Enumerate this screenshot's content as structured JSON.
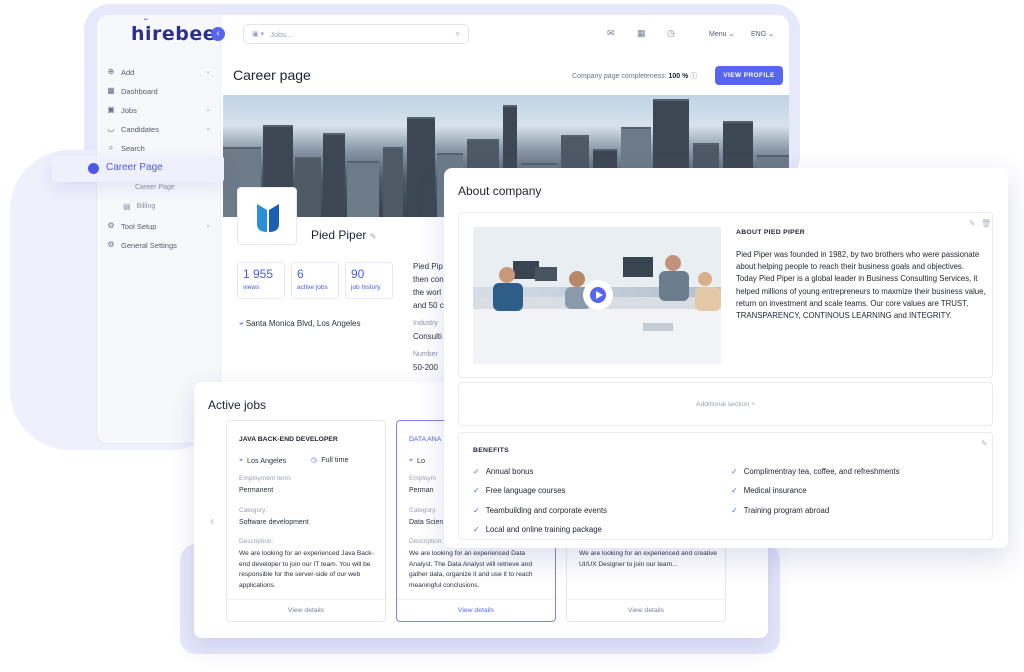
{
  "app": {
    "logo": "hirebee",
    "collapse_icon": "chevron-left-icon",
    "search_placeholder": "Jobs...",
    "menu_label": "Menu",
    "lang_label": "ENG",
    "sidebar": [
      {
        "label": "Add",
        "icon": "plus-circle-icon",
        "has_chevron": true
      },
      {
        "label": "Dashboard",
        "icon": "grid-icon",
        "has_chevron": false
      },
      {
        "label": "Jobs",
        "icon": "briefcase-icon",
        "has_chevron": true
      },
      {
        "label": "Candidates",
        "icon": "user-icon",
        "has_chevron": true
      },
      {
        "label": "Search",
        "icon": "search-icon",
        "has_chevron": false
      }
    ],
    "career_page_label": "Career Page",
    "sub_items": [
      {
        "label": "Career Page"
      },
      {
        "label": "Billing",
        "icon": "card-icon"
      }
    ],
    "sidebar_bottom": [
      {
        "label": "Tool Setup",
        "icon": "tool-icon",
        "has_chevron": true
      },
      {
        "label": "General Settings",
        "icon": "gear-icon",
        "has_chevron": false
      }
    ],
    "page_title": "Career page",
    "completeness_label": "Company page completeness:",
    "completeness_value": "100 %",
    "view_profile_label": "VIEW PROFILE"
  },
  "company": {
    "name": "Pied Piper",
    "stats": [
      {
        "value": "1 955",
        "label": "views"
      },
      {
        "value": "6",
        "label": "active jobs"
      },
      {
        "value": "90",
        "label": "job history"
      }
    ],
    "location": "Santa Monica Blvd, Los Angeles",
    "desc_fragments": [
      "Pied Pip",
      "then con",
      "the worl",
      "and 50 c"
    ],
    "industry_label": "Industry",
    "industry_value": "Consulti",
    "number_label": "Number",
    "number_value": "50-200"
  },
  "jobs": {
    "title": "Active jobs",
    "cards": [
      {
        "title": "JAVA BACK-END DEVELOPER",
        "location": "Los Angeles",
        "term_type": "Full time",
        "employment_label": "Employment term:",
        "employment_value": "Permanent",
        "category_label": "Category:",
        "category_value": "Software development",
        "description_label": "Description:",
        "description": "We are looking for an experienced Java Back-end developer to join our IT team. You will be responsible for the server-side of our web applications.",
        "footer": "View details"
      },
      {
        "title": "DATA ANA",
        "location": "Lo",
        "employment_label": "Employm",
        "employment_value": "Perman",
        "category_label": "Category:",
        "category_value": "Data Scien",
        "description_label": "Description:",
        "description": "We are looking for an experienced Data Analyst. The Data Analyst will retrieve and gather data, organize it and use it to reach meaningful conclusions.",
        "footer": "View details"
      },
      {
        "description": "We are looking for an experienced and creative UI/UX Designer to join our team...",
        "footer": "View details"
      }
    ]
  },
  "about": {
    "title": "About company",
    "heading": "ABOUT PIED PIPER",
    "text": "Pied Piper was founded in 1982, by two brothers who were passionate about helping people to reach their business goals and objectives. Today Pied Piper is a global leader in Business Consulting Services, it helped millions of young entrepreneurs to maxmize their business value, return on investment and scale teams. Our core values are TRUST, TRANSPARENCY, CONTINOUS LEARNING and INTEGRITY.",
    "additional_section_label": "Additional section +",
    "benefits_heading": "BENEFITS",
    "benefits_left": [
      "Annual bonus",
      "Free language courses",
      "Teambuilding and corporate events",
      "Local and online training package"
    ],
    "benefits_right": [
      "Complimentray tea, coffee, and refreshments",
      "Medical insurance",
      "Training program abroad"
    ]
  },
  "colors": {
    "accent": "#5865f2",
    "page_bg": "#e6e8fb"
  }
}
